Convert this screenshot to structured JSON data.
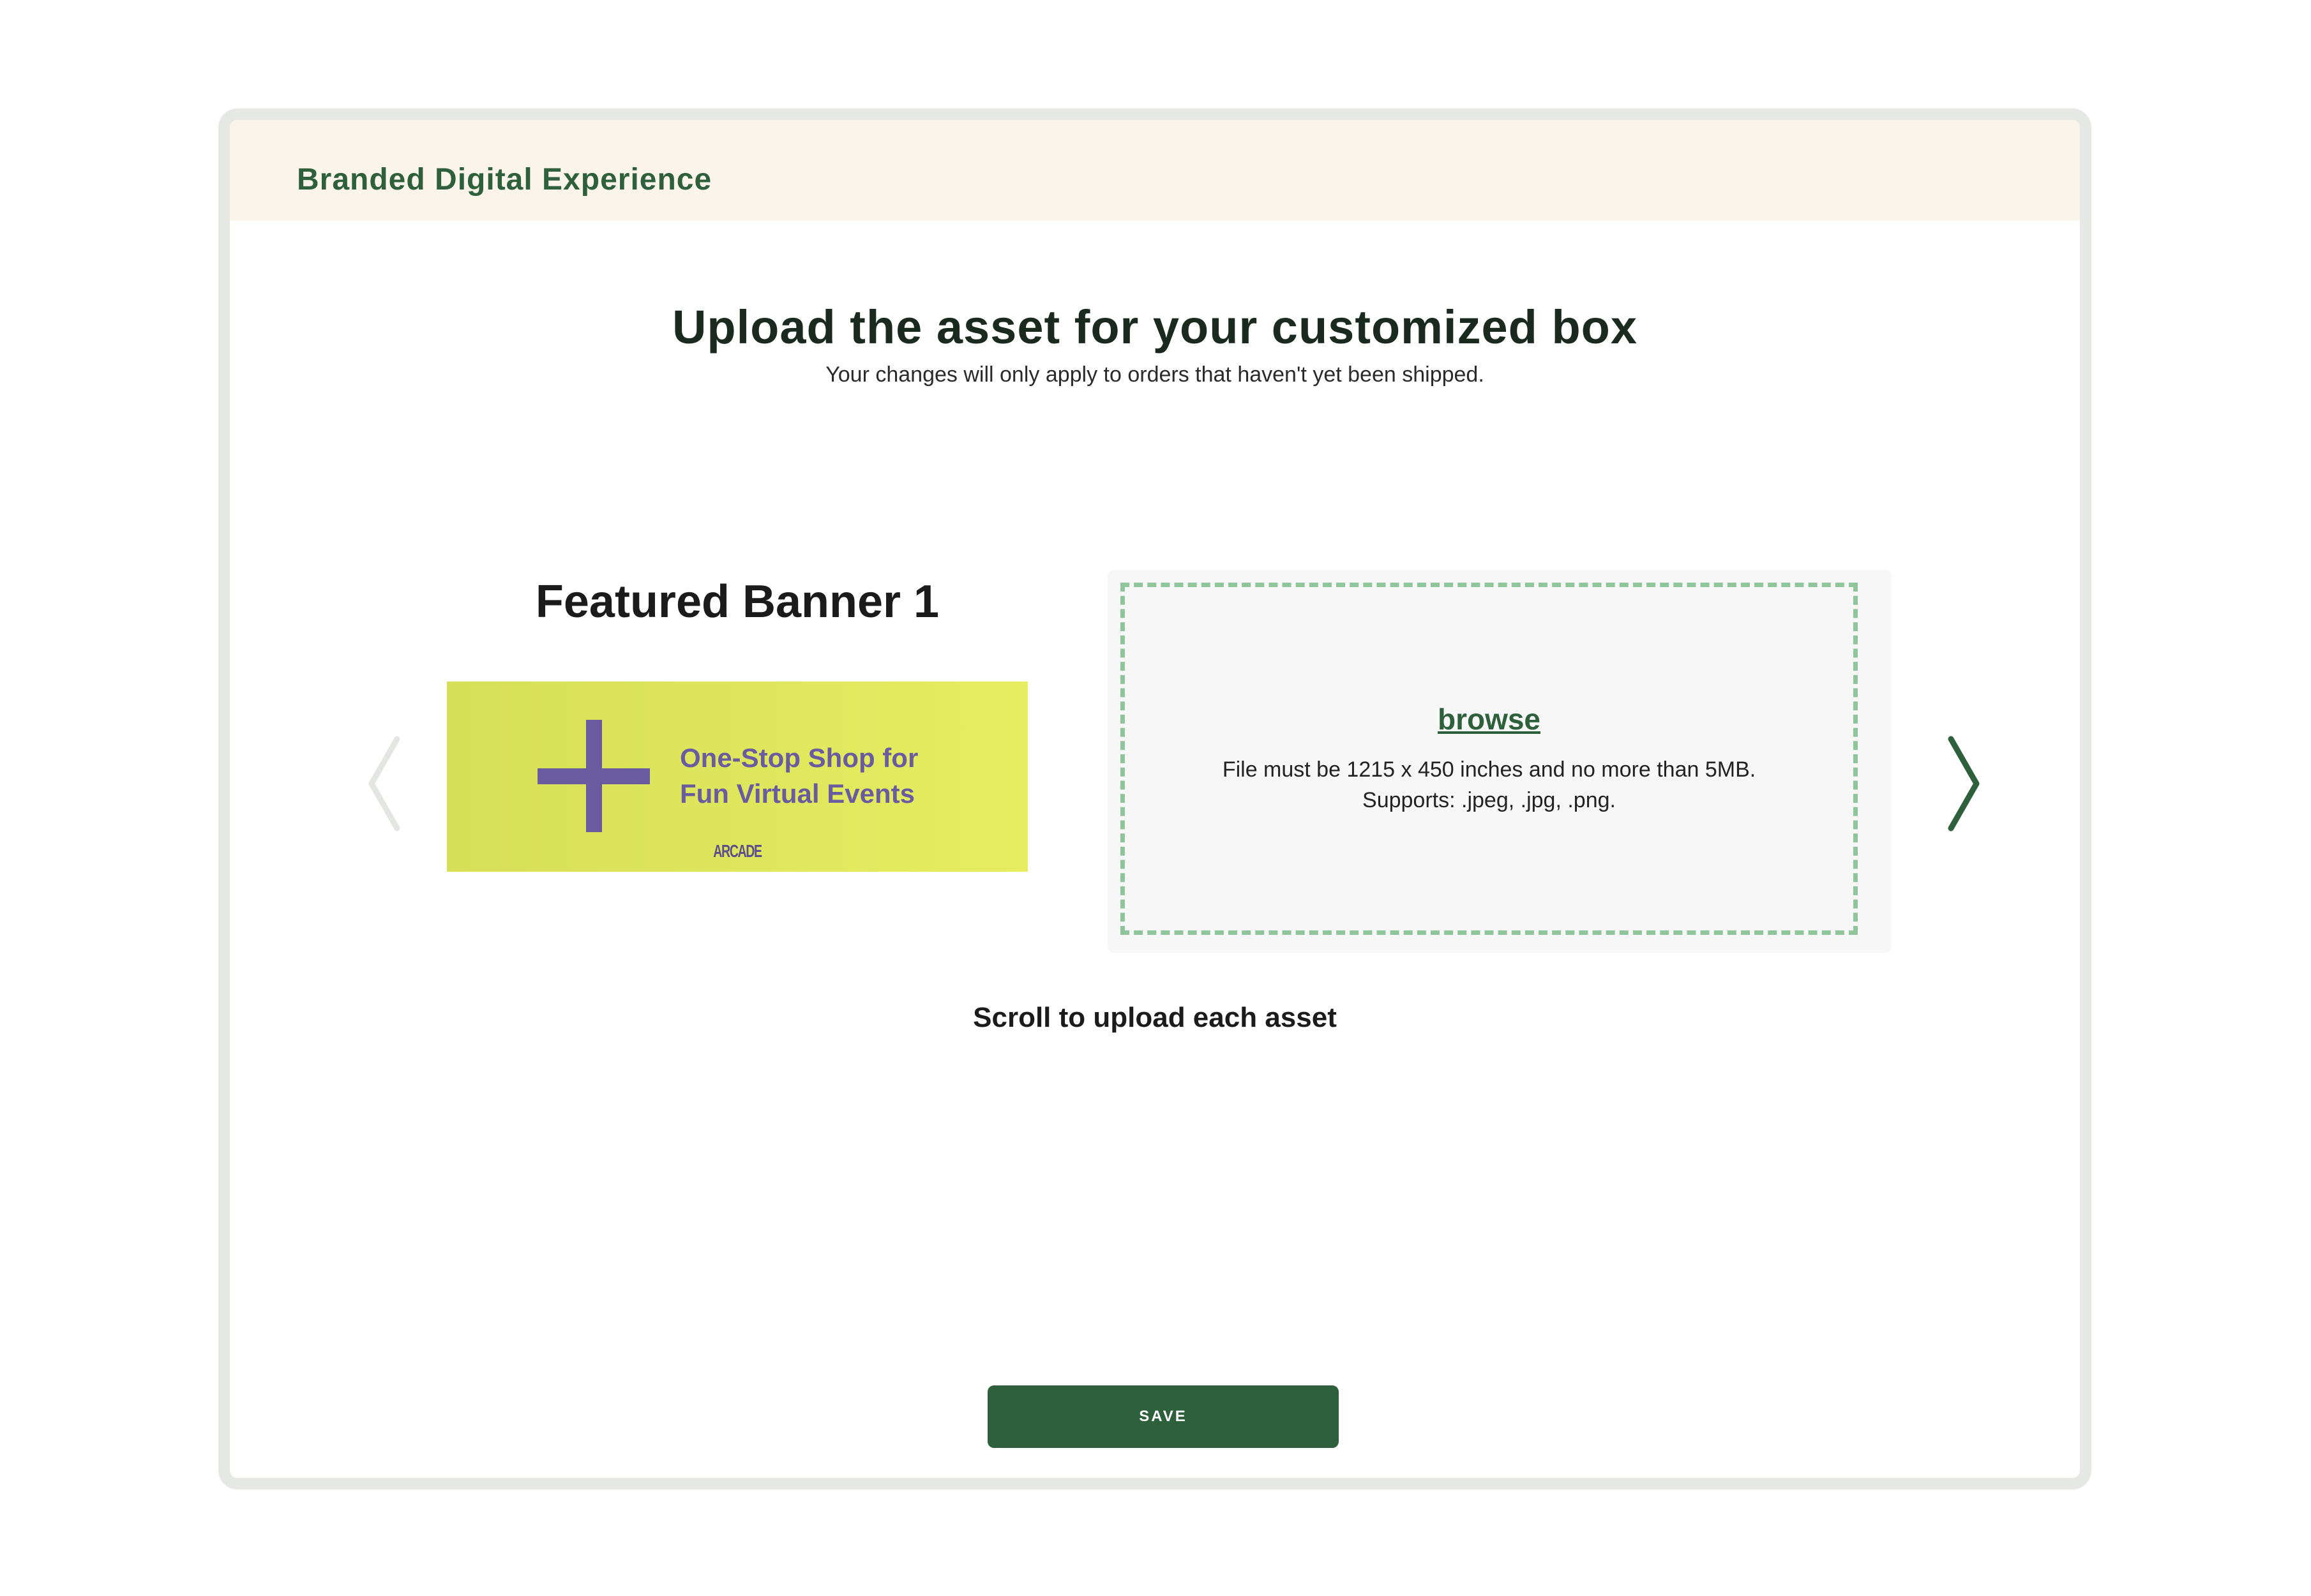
{
  "header": {
    "title": "Branded Digital Experience"
  },
  "main": {
    "title": "Upload the asset for your customized box",
    "subtitle": "Your changes will only apply to orders that haven't yet been shipped."
  },
  "asset": {
    "label": "Featured Banner 1",
    "preview": {
      "text_line1": "One-Stop Shop for",
      "text_line2": "Fun Virtual Events",
      "logo": "ARCADE"
    }
  },
  "upload": {
    "browse_label": "browse",
    "requirements_line1": "File must be 1215 x 450 inches and no more than 5MB.",
    "requirements_line2": "Supports: .jpeg, .jpg, .png."
  },
  "carousel": {
    "prev_icon": "chevron-left-icon",
    "next_icon": "chevron-right-icon",
    "hint": "Scroll to upload each asset"
  },
  "actions": {
    "save_label": "SAVE"
  },
  "colors": {
    "brand_green": "#2e603c",
    "header_bg": "#fbf4ea",
    "dropzone_border": "#8fc59a",
    "banner_purple": "#6a5aa0",
    "banner_yellow": "#e0e85c"
  }
}
